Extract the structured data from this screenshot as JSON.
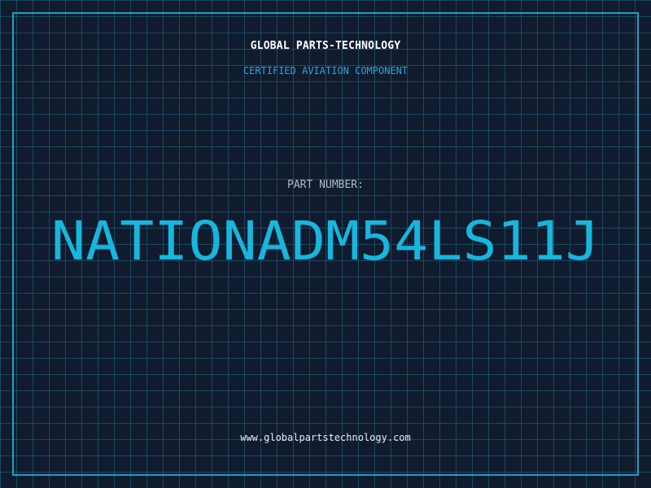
{
  "header": {
    "company": "GLOBAL PARTS-TECHNOLOGY",
    "tagline": "CERTIFIED AVIATION COMPONENT"
  },
  "part": {
    "label": "PART NUMBER:",
    "number": "NATIONADM54LS11J"
  },
  "footer": {
    "website": "www.globalpartstechnology.com"
  },
  "colors": {
    "background": "#111b2e",
    "grid": "#1d6b8a",
    "frame": "#1e9fc7",
    "accent": "#17b6dc",
    "label": "#aeb9c8",
    "text": "#ffffff"
  }
}
